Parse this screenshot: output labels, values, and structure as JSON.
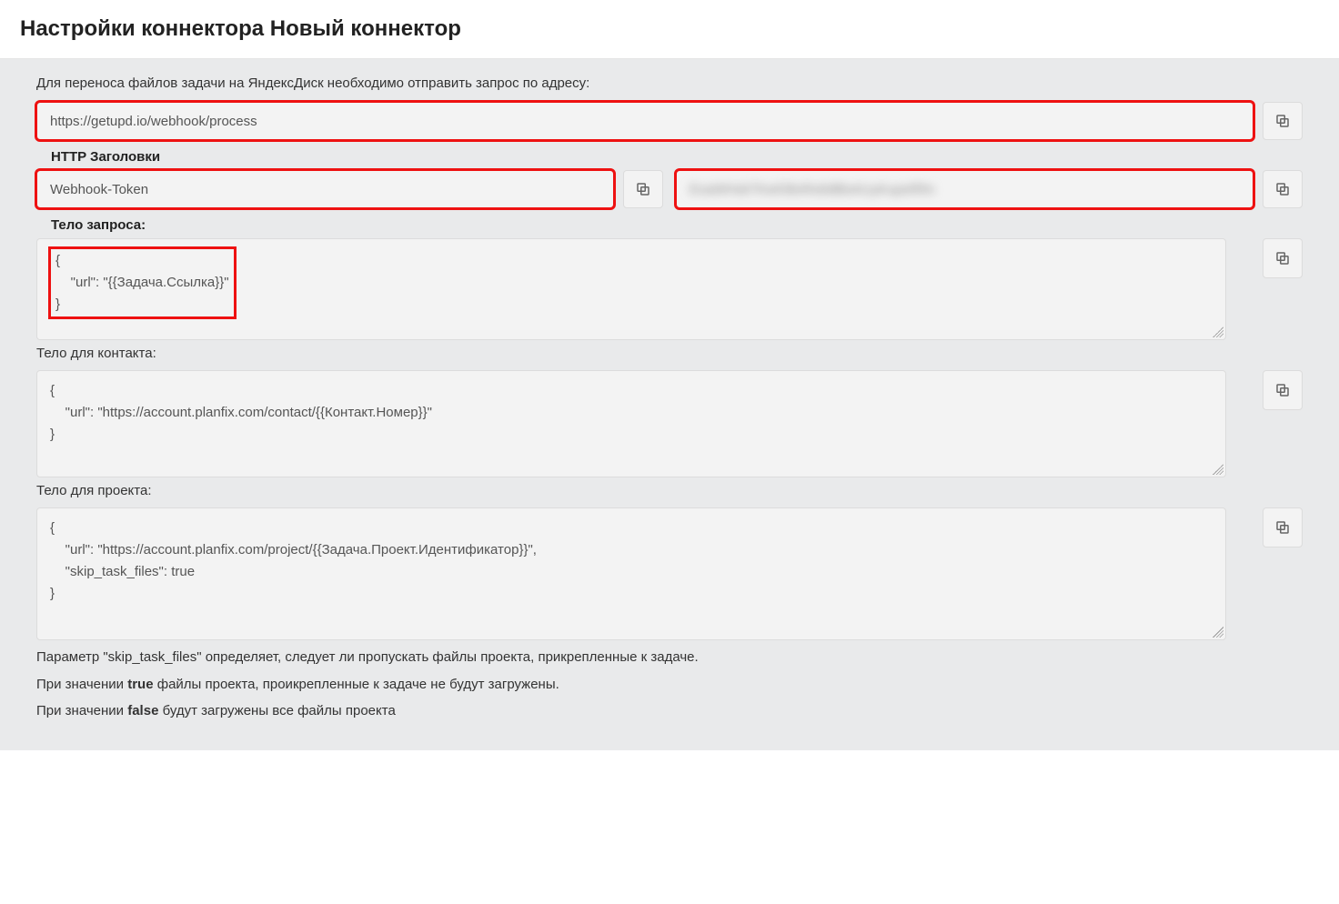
{
  "title": "Настройки коннектора Новый коннектор",
  "intro": "Для переноса файлов задачи на ЯндексДиск необходимо отправить запрос по адресу:",
  "url": "https://getupd.io/webhook/process",
  "headers_label": "HTTP Заголовки",
  "header_name": "Webhook-Token",
  "header_value": "ExaWHskTKwfJ8oRs6dltbxKzyKupsRfm",
  "body_label": "Тело запроса:",
  "body_task": "{\n    \"url\": \"{{Задача.Ссылка}}\"\n}",
  "contact_label": "Тело для контакта:",
  "body_contact": "{\n    \"url\": \"https://account.planfix.com/contact/{{Контакт.Номер}}\"\n}",
  "project_label": "Тело для проекта:",
  "body_project": "{\n    \"url\": \"https://account.planfix.com/project/{{Задача.Проект.Идентификатор}}\",\n    \"skip_task_files\": true\n}",
  "footer": {
    "p1": "Параметр \"skip_task_files\" определяет, следует ли пропускать файлы проекта, прикрепленные к задаче.",
    "p2_a": "При значении ",
    "p2_b": "true",
    "p2_c": " файлы проекта, проикрепленные к задаче не будут загружены.",
    "p3_a": "При значении ",
    "p3_b": "false",
    "p3_c": " будут загружены все файлы проекта"
  }
}
